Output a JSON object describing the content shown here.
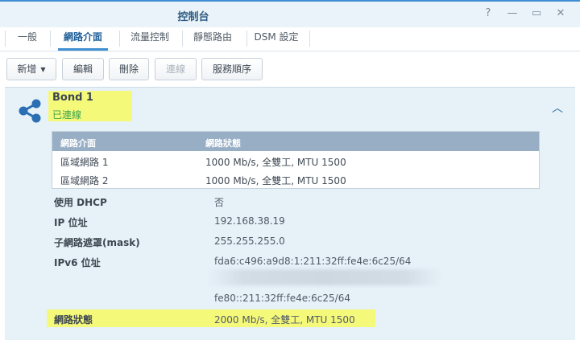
{
  "window": {
    "title": "控制台",
    "controls": {
      "help": "?",
      "minimize": "—",
      "maximize": "▭",
      "close": "✕"
    }
  },
  "tabs": [
    {
      "label": "一般",
      "active": false
    },
    {
      "label": "網路介面",
      "active": true
    },
    {
      "label": "流量控制",
      "active": false
    },
    {
      "label": "靜態路由",
      "active": false
    },
    {
      "label": "DSM 設定",
      "active": false
    }
  ],
  "toolbar": {
    "add_label": "新增",
    "edit_label": "編輯",
    "delete_label": "刪除",
    "connect_label": "連線",
    "service_order_label": "服務順序"
  },
  "interface": {
    "icon": "share-icon",
    "name": "Bond 1",
    "status": "已連線",
    "collapse_icon": "chevron-up-icon",
    "members": {
      "columns": [
        "網路介面",
        "網路狀態"
      ],
      "rows": [
        [
          "區域網路 1",
          "1000 Mb/s, 全雙工, MTU 1500"
        ],
        [
          "區域網路 2",
          "1000 Mb/s, 全雙工, MTU 1500"
        ]
      ]
    },
    "details": {
      "dhcp_label": "使用 DHCP",
      "dhcp_value": "否",
      "ip_label": "IP 位址",
      "ip_value": "192.168.38.19",
      "mask_label": "子網路遮罩(mask)",
      "mask_value": "255.255.255.0",
      "ipv6_label": "IPv6 位址",
      "ipv6_values": [
        "fda6:c496:a9d8:1:211:32ff:fe4e:6c25/64",
        "fe80::211:32ff:fe4e:6c25/64"
      ],
      "status_label": "網路狀態",
      "status_value": "2000 Mb/s, 全雙工, MTU 1500"
    }
  },
  "colors": {
    "accent": "#3f8fd2",
    "connected": "#3aa24a",
    "highlight": "#f5f97a",
    "panel": "#e6f1f8"
  }
}
